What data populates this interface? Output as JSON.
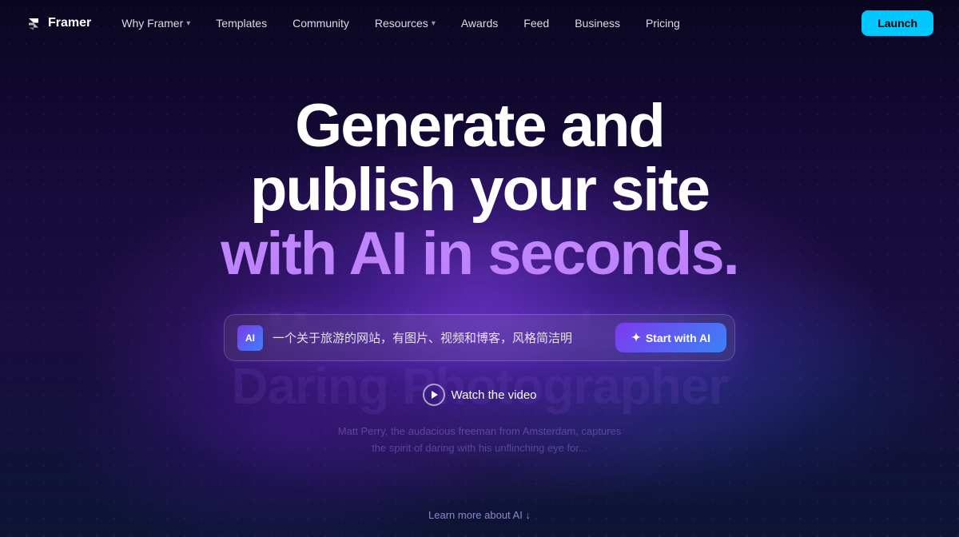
{
  "brand": {
    "name": "Framer",
    "logo_icon": "⬡"
  },
  "nav": {
    "links": [
      {
        "label": "Why Framer",
        "has_dropdown": true
      },
      {
        "label": "Templates",
        "has_dropdown": false
      },
      {
        "label": "Community",
        "has_dropdown": false
      },
      {
        "label": "Resources",
        "has_dropdown": true
      },
      {
        "label": "Awards",
        "has_dropdown": false
      },
      {
        "label": "Feed",
        "has_dropdown": false
      },
      {
        "label": "Business",
        "has_dropdown": false
      },
      {
        "label": "Pricing",
        "has_dropdown": false
      }
    ],
    "cta_label": "Launch"
  },
  "hero": {
    "title_line1": "Generate and",
    "title_line2": "publish your site",
    "title_line3": "with AI in seconds.",
    "ai_icon_label": "AI",
    "ai_placeholder": "一个关于旅游的网站，有图片、视频和博客，风格简洁明",
    "ai_button_label": "Start with AI",
    "watch_label": "Watch the video"
  },
  "bg_text": {
    "line1": "Meet Amsterdams",
    "line2": "Daring Photographer",
    "sub": "Matt Perry, the audacious freeman from Amsterdam, captures\nthe spirit of daring with his unflinching eye for..."
  },
  "learn_more": {
    "label": "Learn more about AI ↓"
  },
  "colors": {
    "accent_cyan": "#00c8ff",
    "accent_purple": "#7c3aed",
    "accent_blue": "#3b82f6",
    "text_purple": "#c084fc"
  }
}
